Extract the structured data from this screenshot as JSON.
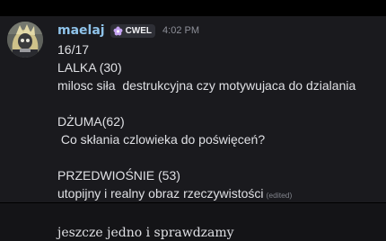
{
  "message": {
    "username": "maelaj",
    "tag": {
      "icon": "flower-icon",
      "label": "CWEL"
    },
    "timestamp": "4:02 PM",
    "lines": [
      "16/17",
      "LALKA (30)",
      "milosc siła  destrukcyjna czy motywujaca do dzialania",
      "",
      "DŻUMA(62)",
      " Co skłania czlowieka do poświęceń?",
      "",
      "PRZEDWIOŚNIE (53)",
      "utopijny i realny obraz rzeczywistości"
    ],
    "edited_label": "(edited)"
  },
  "next_message": {
    "text": "jeszcze jedno i sprawdzamy"
  },
  "colors": {
    "username": "#8fc3ea",
    "background": "#1a1a1e",
    "text": "#dfe0e4",
    "tag_icon": "#c5a3f2"
  }
}
